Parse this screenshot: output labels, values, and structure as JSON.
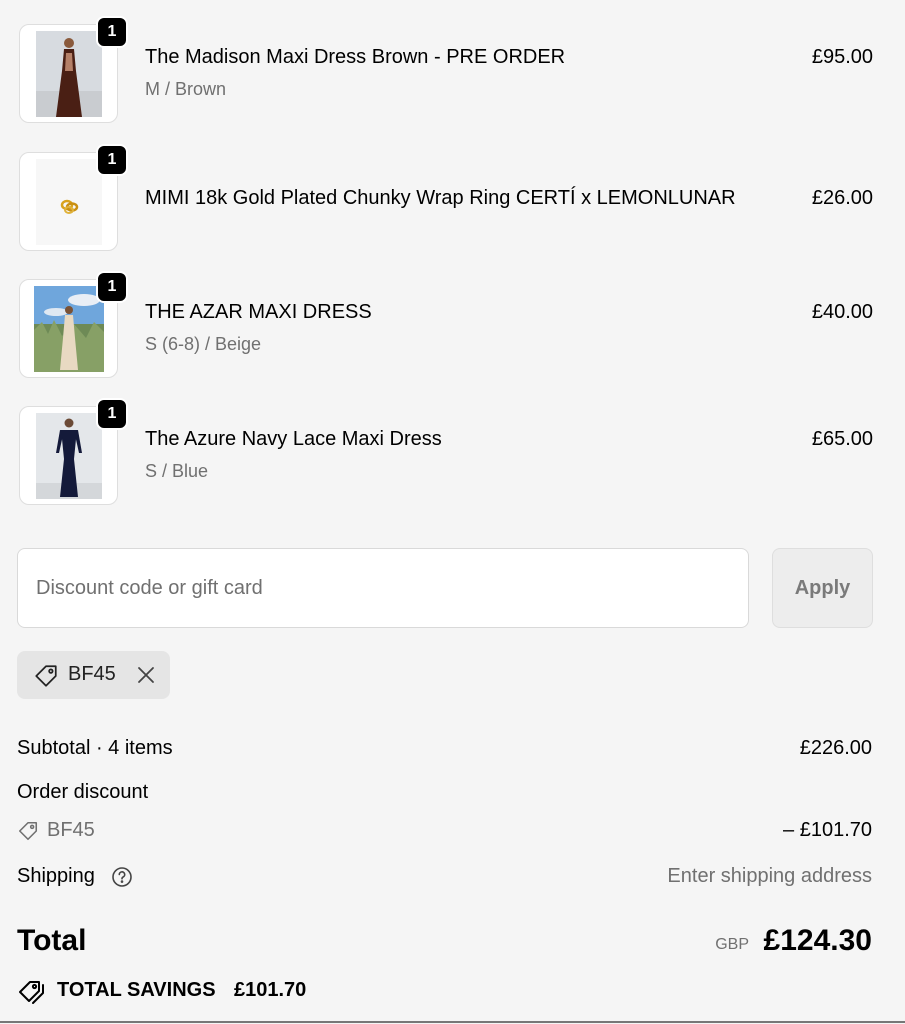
{
  "items": [
    {
      "quantity": "1",
      "name": "The Madison Maxi Dress Brown - PRE ORDER",
      "variant": "M / Brown",
      "price": "£95.00",
      "image_icon": "brown-dress-photo"
    },
    {
      "quantity": "1",
      "name": "MIMI 18k Gold Plated Chunky Wrap Ring CERTÍ x LEMONLUNAR",
      "variant": "",
      "price": "£26.00",
      "image_icon": "gold-ring-photo"
    },
    {
      "quantity": "1",
      "name": "THE AZAR MAXI DRESS",
      "variant": "S (6-8) / Beige",
      "price": "£40.00",
      "image_icon": "beige-dress-photo"
    },
    {
      "quantity": "1",
      "name": "The Azure Navy Lace Maxi Dress",
      "variant": "S / Blue",
      "price": "£65.00",
      "image_icon": "navy-dress-photo"
    }
  ],
  "discount": {
    "placeholder": "Discount code or gift card",
    "apply_label": "Apply",
    "applied_code": "BF45"
  },
  "summary": {
    "subtotal_label": "Subtotal · 4 items",
    "subtotal_value": "£226.00",
    "order_discount_label": "Order discount",
    "discount_code": "BF45",
    "discount_value": "– £101.70",
    "shipping_label": "Shipping",
    "shipping_value": "Enter shipping address",
    "total_label": "Total",
    "currency": "GBP",
    "total_value": "£124.30",
    "savings_label": "TOTAL SAVINGS",
    "savings_value": "£101.70"
  },
  "colors": {
    "background": "#f5f5f5",
    "badge": "#000000",
    "muted_text": "#707070"
  }
}
